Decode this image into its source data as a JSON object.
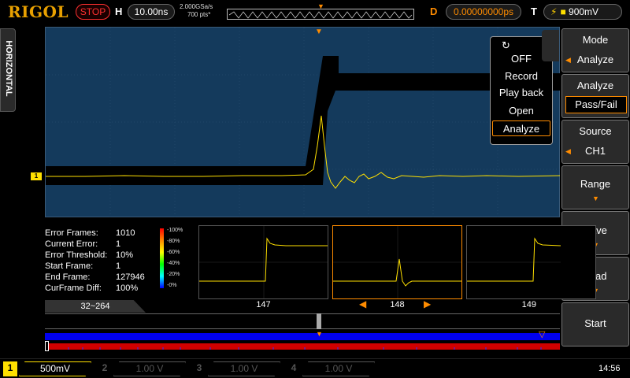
{
  "topbar": {
    "logo": "RIGOL",
    "run_state": "STOP",
    "horizontal_label": "H",
    "timebase": "10.00ns",
    "sample_rate": "2.000GSa/s",
    "memory_depth": "700  pts*",
    "delay_label": "D",
    "delay_value": "0.00000000ps",
    "trigger_label": "T",
    "trigger_level": "900mV"
  },
  "side_tab": {
    "label": "HORIZONTAL"
  },
  "waveform": {
    "channel_marker": "1",
    "channel_color": "#ffe000",
    "background_color": "#143a5c"
  },
  "popup_menu": {
    "items": [
      "OFF",
      "Record",
      "Play back",
      "Open",
      "Analyze"
    ],
    "selected": "Analyze"
  },
  "softkeys": {
    "mode": {
      "title": "Mode",
      "value": "Analyze"
    },
    "analyze": {
      "title": "Analyze",
      "value": "Pass/Fail"
    },
    "source": {
      "title": "Source",
      "value": "CH1"
    },
    "range": {
      "title": "Range"
    },
    "save": {
      "title": "Save"
    },
    "load": {
      "title": "Load"
    },
    "start": {
      "title": "Start"
    }
  },
  "analysis": {
    "rows": [
      {
        "key": "Error Frames:",
        "value": "1010"
      },
      {
        "key": "Current Error:",
        "value": "1"
      },
      {
        "key": "Error Threshold:",
        "value": "10%"
      },
      {
        "key": "Start Frame:",
        "value": "1"
      },
      {
        "key": "End Frame:",
        "value": "127946"
      },
      {
        "key": "CurFrame Diff:",
        "value": "100%"
      }
    ],
    "colorbar_labels": [
      "-100%",
      "-80%",
      "-60%",
      "-40%",
      "-20%",
      "-0%"
    ]
  },
  "thumbnails": {
    "frames": [
      "147",
      "148",
      "149"
    ],
    "selected": "148",
    "arrow_left": "◀",
    "arrow_right": "▶"
  },
  "timeline": {
    "range_label": "32~264"
  },
  "bottombar": {
    "channels": [
      {
        "num": "1",
        "value": "500mV"
      },
      {
        "num": "2",
        "value": "1.00 V"
      },
      {
        "num": "3",
        "value": "1.00 V"
      },
      {
        "num": "4",
        "value": "1.00 V"
      }
    ],
    "clock": "14:56"
  }
}
